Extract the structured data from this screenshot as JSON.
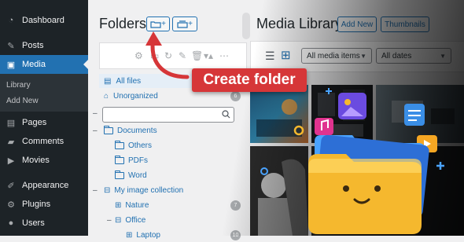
{
  "admin_menu": {
    "items": [
      {
        "label": "Dashboard",
        "icon": "dashboard-icon"
      },
      {
        "label": "Posts",
        "icon": "pin-icon"
      },
      {
        "label": "Media",
        "icon": "media-icon",
        "active": true
      },
      {
        "label": "Pages",
        "icon": "pages-icon"
      },
      {
        "label": "Comments",
        "icon": "comment-icon"
      },
      {
        "label": "Movies",
        "icon": "video-icon"
      },
      {
        "label": "Appearance",
        "icon": "brush-icon"
      },
      {
        "label": "Plugins",
        "icon": "plugin-icon"
      },
      {
        "label": "Users",
        "icon": "user-icon"
      }
    ],
    "submenu": [
      "Library",
      "Add New"
    ]
  },
  "folders": {
    "title": "Folders",
    "new_folder_btn": "+",
    "new_collection_btn": "+",
    "tree": [
      {
        "label": "All files",
        "icon": "files-icon"
      },
      {
        "label": "Unorganized",
        "icon": "home-icon",
        "count": "6"
      },
      {
        "label": "Documents",
        "icon": "folder-icon"
      },
      {
        "label": "Others",
        "icon": "folder-icon"
      },
      {
        "label": "PDFs",
        "icon": "folder-icon"
      },
      {
        "label": "Word",
        "icon": "folder-icon"
      },
      {
        "label": "My image collection",
        "icon": "collection-icon"
      },
      {
        "label": "Nature",
        "icon": "grid-icon",
        "count": "7"
      },
      {
        "label": "Office",
        "icon": "collection-icon"
      },
      {
        "label": "Laptop",
        "icon": "grid-icon",
        "count": "10"
      }
    ]
  },
  "media": {
    "title": "Media Library",
    "add_new": "Add New",
    "thumbnails": "Thumbnails",
    "filter_type": "All media items",
    "filter_date": "All dates"
  },
  "callout": {
    "text": "Create folder"
  },
  "colors": {
    "admin_bg": "#1d2327",
    "accent": "#2271b1",
    "callout": "#d63638",
    "folder": "#f5b82e"
  }
}
